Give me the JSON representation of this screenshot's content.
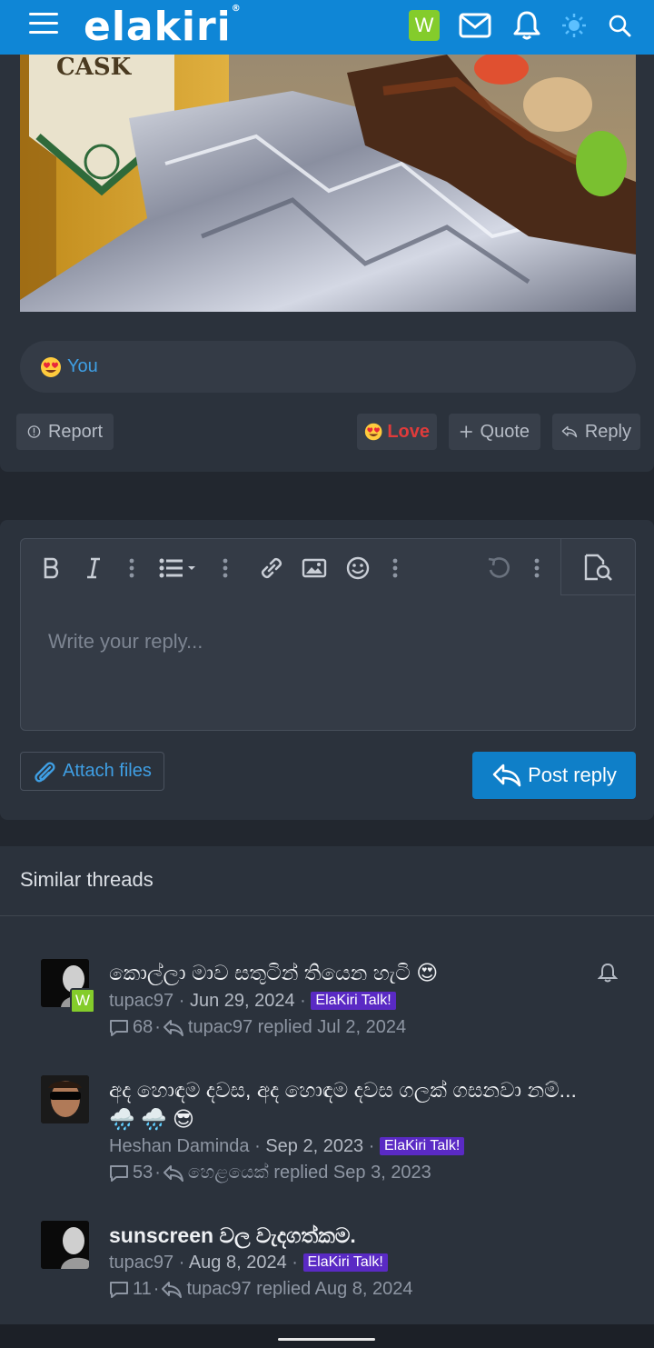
{
  "header": {
    "logo": "elakiri",
    "logo_mark": "®",
    "user_initial": "W",
    "icons": [
      "menu-icon",
      "mail-icon",
      "bell-icon",
      "theme-icon",
      "search-icon"
    ]
  },
  "post": {
    "reactions_summary": "You",
    "actions": {
      "report": "Report",
      "love": "Love",
      "quote": "Quote",
      "reply": "Reply"
    }
  },
  "reply_form": {
    "placeholder": "Write your reply...",
    "attach_label": "Attach files",
    "post_label": "Post reply"
  },
  "similar": {
    "title": "Similar threads",
    "threads": [
      {
        "title": "කොල්ලා මාව සතුටින් තියෙන හැටි 😍",
        "author": "tupac97",
        "date": "Jun 29, 2024",
        "tag": "ElaKiri Talk!",
        "replies": "68",
        "last_reply": "tupac97 replied Jul 2, 2024"
      },
      {
        "title": "අද හොඳම දවස, අද හොඳම දවස ගලක් ගසනවා නම්... 🌧️ 🌧️ 😎",
        "author": "Heshan Daminda",
        "date": "Sep 2, 2023",
        "tag": "ElaKiri Talk!",
        "replies": "53",
        "last_reply": "හෙළයෙක් replied Sep 3, 2023"
      },
      {
        "title": "sunscreen වල වැදගත්කම.",
        "author": "tupac97",
        "date": "Aug 8, 2024",
        "tag": "ElaKiri Talk!",
        "replies": "11",
        "last_reply": "tupac97 replied Aug 8, 2024"
      }
    ]
  },
  "colors": {
    "brand": "#0f86d6",
    "accent_link": "#3f9fe4",
    "love_red": "#e03b3b",
    "tag_purple": "#5a2ac4",
    "user_badge_green": "#84cc2b"
  }
}
